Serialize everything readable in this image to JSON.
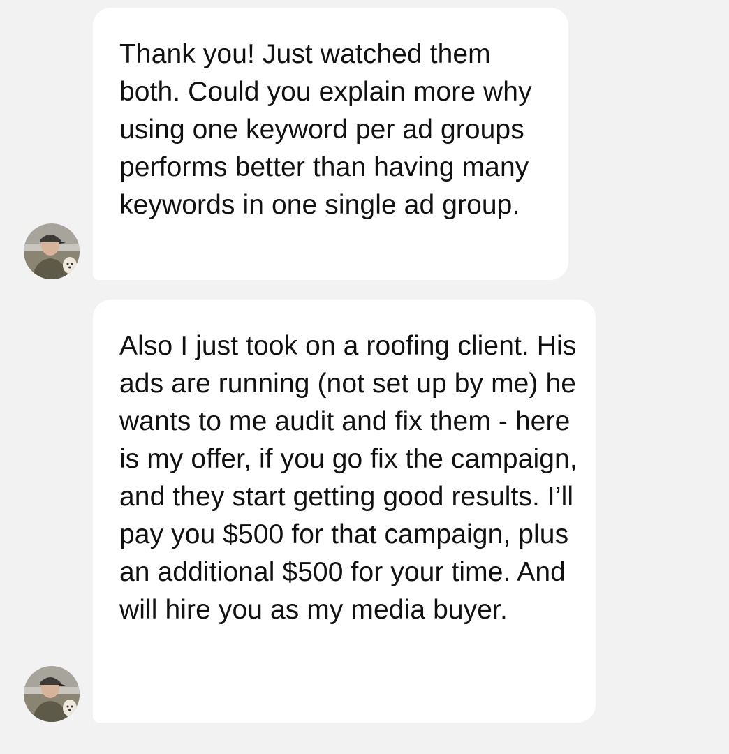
{
  "conversation": {
    "messages": [
      {
        "sender_avatar": "user-avatar-photo",
        "text": "Thank you! Just watched them both. Could you explain more why using one keyword per ad groups performs better than having many keywords in one single ad group."
      },
      {
        "sender_avatar": "user-avatar-photo",
        "text": "Also I just took on a roofing client. His ads are running (not set up by me) he wants to me audit and fix them - here is my offer, if you go fix the campaign, and they start getting good results. I’ll pay you $500 for that campaign, plus an additional $500 for your time. And will hire you as my media buyer."
      }
    ]
  },
  "colors": {
    "background": "#f2f2f2",
    "bubble": "#ffffff",
    "text": "#111111"
  }
}
